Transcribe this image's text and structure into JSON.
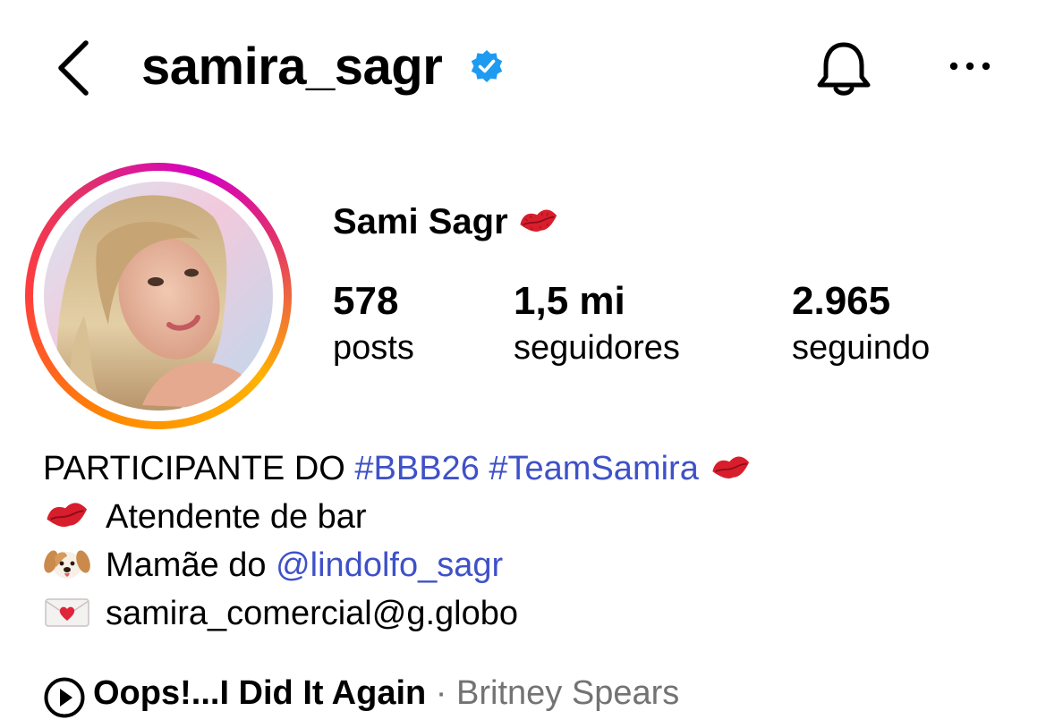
{
  "header": {
    "username": "samira_sagr",
    "verified": true,
    "back_icon": "chevron-left-icon",
    "verified_icon": "verified-badge-icon",
    "notification_icon": "bell-icon",
    "more_icon": "more-horizontal-icon"
  },
  "profile": {
    "display_name": "Sami Sagr",
    "name_emoji": "kiss-mark-icon",
    "avatar_ring_colors": [
      "#ff8a00",
      "#e1306c",
      "#d300c5",
      "#ffb200"
    ]
  },
  "stats": [
    {
      "value": "578",
      "label": "posts"
    },
    {
      "value": "1,5 mi",
      "label": "seguidores"
    },
    {
      "value": "2.965",
      "label": "seguindo"
    }
  ],
  "bio": {
    "line1_text": "PARTICIPANTE DO ",
    "line1_hashtag1": "#BBB26",
    "line1_hashtag2": "#TeamSamira",
    "line2_text": "Atendente de bar",
    "line3_text": "Mamãe do ",
    "line3_mention": "@lindolfo_sagr",
    "line4_text": "samira_comercial@g.globo",
    "link_color": "#3f51c7"
  },
  "music": {
    "title": "Oops!...I Did It Again",
    "separator": " · ",
    "artist": "Britney Spears",
    "icon": "play-circle-icon"
  }
}
